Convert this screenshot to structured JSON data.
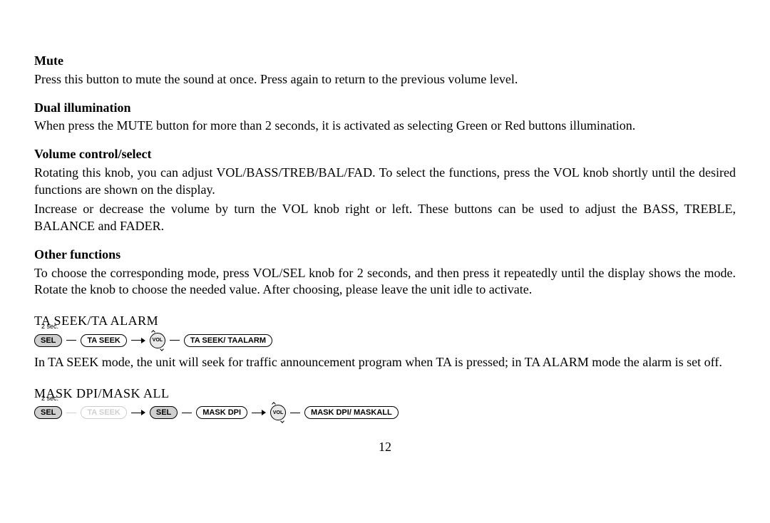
{
  "sections": {
    "mute": {
      "heading": "Mute",
      "text": "Press this button to mute the sound at once. Press again to return to the previous volume level."
    },
    "dual": {
      "heading": "Dual illumination",
      "text": "When press the MUTE button for more than 2 seconds, it is activated as selecting Green or Red buttons illumination."
    },
    "volume": {
      "heading": "Volume control/select",
      "text1": "Rotating this knob, you can adjust VOL/BASS/TREB/BAL/FAD. To select the functions, press the VOL knob shortly until the desired functions are shown on the display.",
      "text2": "Increase or decrease the volume by turn the VOL knob right or left. These buttons can be used to adjust the BASS, TREBLE, BALANCE and FADER."
    },
    "other": {
      "heading": "Other functions",
      "text": "To choose the corresponding mode, press VOL/SEL knob for 2 seconds, and then press it repeatedly until the display shows the mode. Rotate the knob to choose the needed value. After choosing, please leave the unit idle to activate."
    },
    "taseek": {
      "heading": "TA SEEK/TA ALARM",
      "text": "In TA SEEK mode, the unit will seek for traffic announcement program when TA is pressed; in TA ALARM mode the alarm is set off."
    },
    "mask": {
      "heading": "MASK DPI/MASK ALL"
    }
  },
  "diagram1": {
    "duration": "2 sec.",
    "sel": "SEL",
    "ta_seek": "TA SEEK",
    "vol": "VOL",
    "result": "TA SEEK/  TAALARM"
  },
  "diagram2": {
    "duration": "2 sec.",
    "sel1": "SEL",
    "ta_seek": "TA SEEK",
    "sel2": "SEL",
    "mask_dpi": "MASK DPI",
    "vol": "VOL",
    "result": "MASK DPI/  MASKALL"
  },
  "page_number": "12"
}
